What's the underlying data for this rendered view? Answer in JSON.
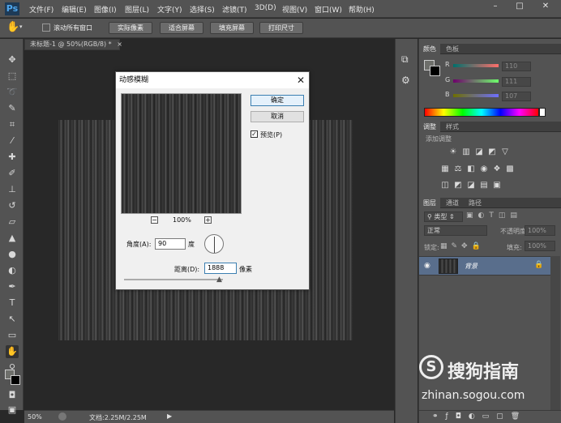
{
  "app": {
    "logo": "Ps"
  },
  "menu": [
    "文件(F)",
    "编辑(E)",
    "图像(I)",
    "图层(L)",
    "文字(Y)",
    "选择(S)",
    "滤镜(T)",
    "3D(D)",
    "视图(V)",
    "窗口(W)",
    "帮助(H)"
  ],
  "window_controls": {
    "minimize": "–",
    "restore": "□",
    "close": "✕"
  },
  "options_bar": {
    "scroll_all_label": "滚动所有窗口",
    "buttons": [
      "实际像素",
      "适合屏幕",
      "填充屏幕",
      "打印尺寸"
    ]
  },
  "document_tab": {
    "title": "未标题-1 @ 50%(RGB/8) *",
    "close": "×"
  },
  "status_bar": {
    "zoom": "50%",
    "doc_info": "文档:2.25M/2.25M"
  },
  "color_panel": {
    "tabs": [
      "颜色",
      "色板"
    ],
    "channels": [
      {
        "name": "R",
        "value": "110"
      },
      {
        "name": "G",
        "value": "111"
      },
      {
        "name": "B",
        "value": "107"
      }
    ]
  },
  "adjustments_panel": {
    "tabs": [
      "调整",
      "样式"
    ],
    "heading": "添加调整"
  },
  "layers_panel": {
    "tabs": [
      "图层",
      "通道",
      "路径"
    ],
    "filter_kind": "类型",
    "blend_mode": "正常",
    "opacity_label": "不透明度:",
    "opacity_value": "100%",
    "lock_label": "锁定:",
    "fill_label": "填充:",
    "fill_value": "100%",
    "layers": [
      {
        "name": "背景"
      }
    ]
  },
  "dialog": {
    "title": "动感模糊",
    "close": "✕",
    "ok": "确定",
    "cancel": "取消",
    "preview_label": "预览(P)",
    "preview_checked": true,
    "zoom_out": "−",
    "zoom": "100%",
    "zoom_in": "+",
    "angle_label": "角度(A):",
    "angle_value": "90",
    "angle_unit": "度",
    "distance_label": "距离(D):",
    "distance_value": "1888",
    "distance_unit": "像素"
  },
  "watermark": {
    "brand": "搜狗指南",
    "url": "zhinan.sogou.com"
  }
}
